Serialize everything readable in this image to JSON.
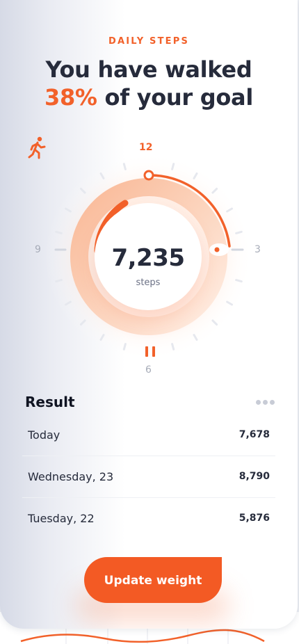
{
  "header": {
    "eyebrow": "DAILY STEPS",
    "line1": "You have walked",
    "percent": "38%",
    "line2_rest": " of your goal"
  },
  "dial": {
    "label_12": "12",
    "label_9": "9",
    "label_3": "3",
    "label_6": "6",
    "steps_value": "7,235",
    "steps_unit": "steps",
    "progress_fraction": 0.38,
    "icons": {
      "center": "walking-person-icon",
      "control": "pause-icon"
    }
  },
  "result": {
    "title": "Result",
    "menu_icon": "more-dots-icon",
    "rows": [
      {
        "label": "Today",
        "value": "7,678"
      },
      {
        "label": "Wednesday, 23",
        "value": "8,790"
      },
      {
        "label": "Tuesday, 22",
        "value": "5,876"
      }
    ]
  },
  "actions": {
    "update_label": "Update weight"
  },
  "colors": {
    "accent": "#f2612a",
    "button": "#f35a24",
    "text_dark": "#262b3b",
    "muted": "#a7acb8"
  }
}
